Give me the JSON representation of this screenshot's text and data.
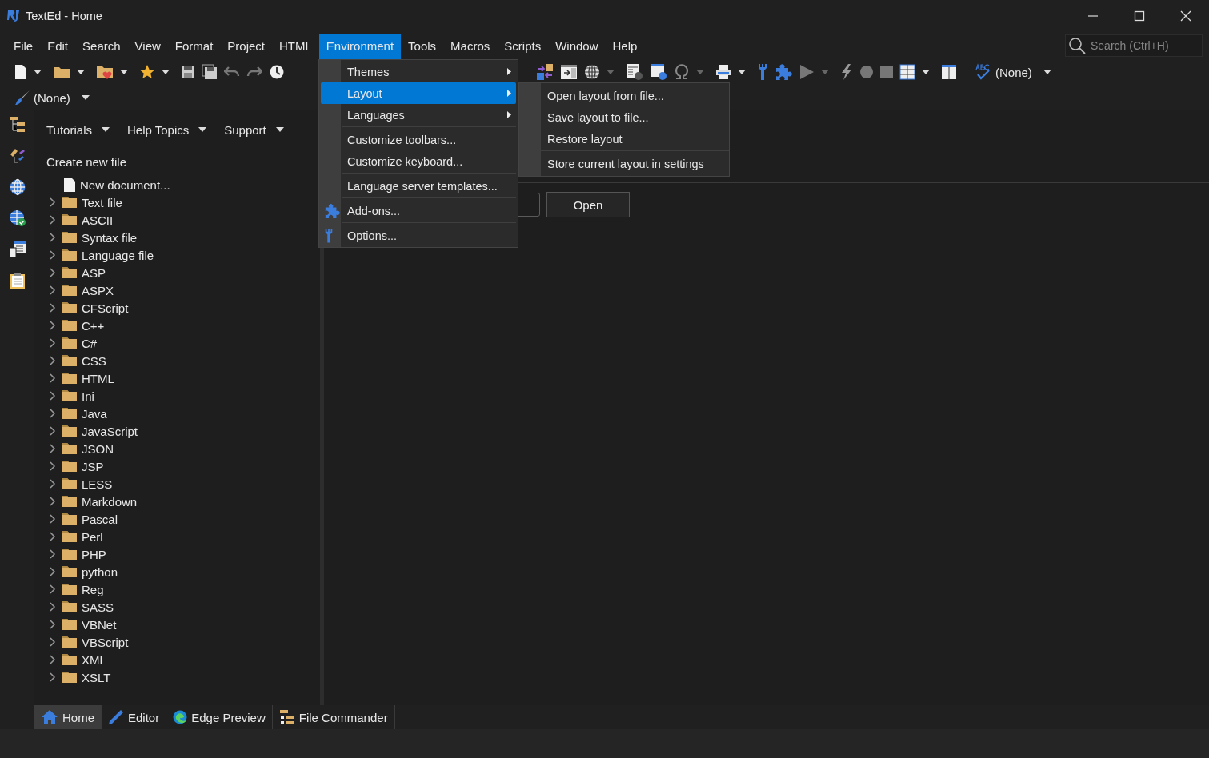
{
  "window": {
    "title": "TextEd - Home"
  },
  "menu_bar": [
    {
      "label": "File",
      "selected": false
    },
    {
      "label": "Edit",
      "selected": false
    },
    {
      "label": "Search",
      "selected": false
    },
    {
      "label": "View",
      "selected": false
    },
    {
      "label": "Format",
      "selected": false
    },
    {
      "label": "Project",
      "selected": false
    },
    {
      "label": "HTML",
      "selected": false
    },
    {
      "label": "Environment",
      "selected": true
    },
    {
      "label": "Tools",
      "selected": false
    },
    {
      "label": "Macros",
      "selected": false
    },
    {
      "label": "Scripts",
      "selected": false
    },
    {
      "label": "Window",
      "selected": false
    },
    {
      "label": "Help",
      "selected": false
    }
  ],
  "search": {
    "placeholder": "Search (Ctrl+H)"
  },
  "toolbar": {
    "spell_combo": "(None)",
    "brush_combo": "(None)"
  },
  "environment_menu": [
    {
      "kind": "submenu",
      "label": "Themes",
      "selected": false
    },
    {
      "kind": "submenu",
      "label": "Layout",
      "selected": true
    },
    {
      "kind": "submenu",
      "label": "Languages",
      "selected": false
    },
    {
      "kind": "separator"
    },
    {
      "kind": "item",
      "label": "Customize toolbars...",
      "selected": false
    },
    {
      "kind": "item",
      "label": "Customize keyboard...",
      "selected": false
    },
    {
      "kind": "separator"
    },
    {
      "kind": "item",
      "label": "Language server templates...",
      "selected": false
    },
    {
      "kind": "separator"
    },
    {
      "kind": "item",
      "label": "Add-ons...",
      "selected": false
    },
    {
      "kind": "separator"
    },
    {
      "kind": "item",
      "label": "Options...",
      "selected": false
    }
  ],
  "layout_submenu": [
    {
      "kind": "item",
      "label": "Open layout from file..."
    },
    {
      "kind": "item",
      "label": "Save layout to file..."
    },
    {
      "kind": "item",
      "label": "Restore layout"
    },
    {
      "kind": "separator"
    },
    {
      "kind": "item",
      "label": "Store current layout in settings"
    }
  ],
  "home_panel": {
    "links": [
      "Tutorials",
      "Help Topics",
      "Support"
    ],
    "heading": "Create new file",
    "items": [
      {
        "kind": "document",
        "label": "New document..."
      },
      {
        "kind": "folder",
        "label": "Text file",
        "expanded": false
      },
      {
        "kind": "folder",
        "label": "ASCII",
        "expanded": false
      },
      {
        "kind": "folder",
        "label": "Syntax file",
        "expanded": false
      },
      {
        "kind": "folder",
        "label": "Language file",
        "expanded": false
      },
      {
        "kind": "folder",
        "label": "ASP",
        "expanded": false
      },
      {
        "kind": "folder",
        "label": "ASPX",
        "expanded": false
      },
      {
        "kind": "folder",
        "label": "CFScript",
        "expanded": false
      },
      {
        "kind": "folder",
        "label": "C++",
        "expanded": false
      },
      {
        "kind": "folder",
        "label": "C#",
        "expanded": false
      },
      {
        "kind": "folder",
        "label": "CSS",
        "expanded": false
      },
      {
        "kind": "folder",
        "label": "HTML",
        "expanded": false
      },
      {
        "kind": "folder",
        "label": "Ini",
        "expanded": false
      },
      {
        "kind": "folder",
        "label": "Java",
        "expanded": false
      },
      {
        "kind": "folder",
        "label": "JavaScript",
        "expanded": false
      },
      {
        "kind": "folder",
        "label": "JSON",
        "expanded": false
      },
      {
        "kind": "folder",
        "label": "JSP",
        "expanded": false
      },
      {
        "kind": "folder",
        "label": "LESS",
        "expanded": false
      },
      {
        "kind": "folder",
        "label": "Markdown",
        "expanded": false
      },
      {
        "kind": "folder",
        "label": "Pascal",
        "expanded": false
      },
      {
        "kind": "folder",
        "label": "Perl",
        "expanded": false
      },
      {
        "kind": "folder",
        "label": "PHP",
        "expanded": false
      },
      {
        "kind": "folder",
        "label": "python",
        "expanded": false
      },
      {
        "kind": "folder",
        "label": "Reg",
        "expanded": false
      },
      {
        "kind": "folder",
        "label": "SASS",
        "expanded": false
      },
      {
        "kind": "folder",
        "label": "VBNet",
        "expanded": false
      },
      {
        "kind": "folder",
        "label": "VBScript",
        "expanded": false
      },
      {
        "kind": "folder",
        "label": "XML",
        "expanded": false
      },
      {
        "kind": "folder",
        "label": "XSLT",
        "expanded": false
      }
    ]
  },
  "content": {
    "open_button": "Open"
  },
  "bottom_tabs": [
    {
      "label": "Home",
      "selected": true
    },
    {
      "label": "Editor",
      "selected": false
    },
    {
      "label": "Edge Preview",
      "selected": false
    },
    {
      "label": "File Commander",
      "selected": false
    }
  ]
}
